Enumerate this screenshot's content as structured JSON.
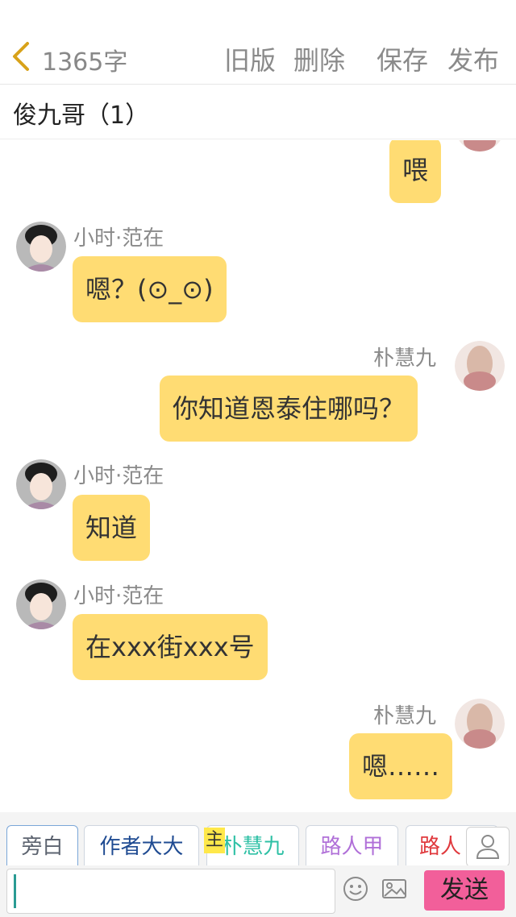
{
  "header": {
    "word_count": "1365字",
    "old_version_label": "旧版",
    "delete_label": "删除",
    "save_label": "保存",
    "publish_label": "发布"
  },
  "chat_title": "俊九哥（1）",
  "messages": [
    {
      "side": "right",
      "name": "",
      "text": "喂"
    },
    {
      "side": "left",
      "name": "小时·范在",
      "text": "嗯？(⊙_⊙)"
    },
    {
      "side": "right",
      "name": "朴慧九",
      "text": "你知道恩泰住哪吗？"
    },
    {
      "side": "left",
      "name": "小时·范在",
      "text": "知道"
    },
    {
      "side": "left",
      "name": "小时·范在",
      "text": "在xxx街xxx号"
    },
    {
      "side": "right",
      "name": "朴慧九",
      "text": "嗯……"
    }
  ],
  "roles": {
    "narration": "旁白",
    "author": "作者大大",
    "host_badge": "主",
    "hyegu": "朴慧九",
    "passerby_a": "路人甲",
    "passerby_b": "路人"
  },
  "role_colors": {
    "narration": "#5d6470",
    "author": "#1f4b92",
    "hyegu": "#2ec0a5",
    "passerby_a": "#b070d8",
    "passerby_b": "#e0393d"
  },
  "input": {
    "value": "",
    "placeholder": ""
  },
  "send_label": "发送",
  "icons": [
    "chevron-left-icon",
    "emoji-icon",
    "image-icon",
    "user-icon"
  ]
}
